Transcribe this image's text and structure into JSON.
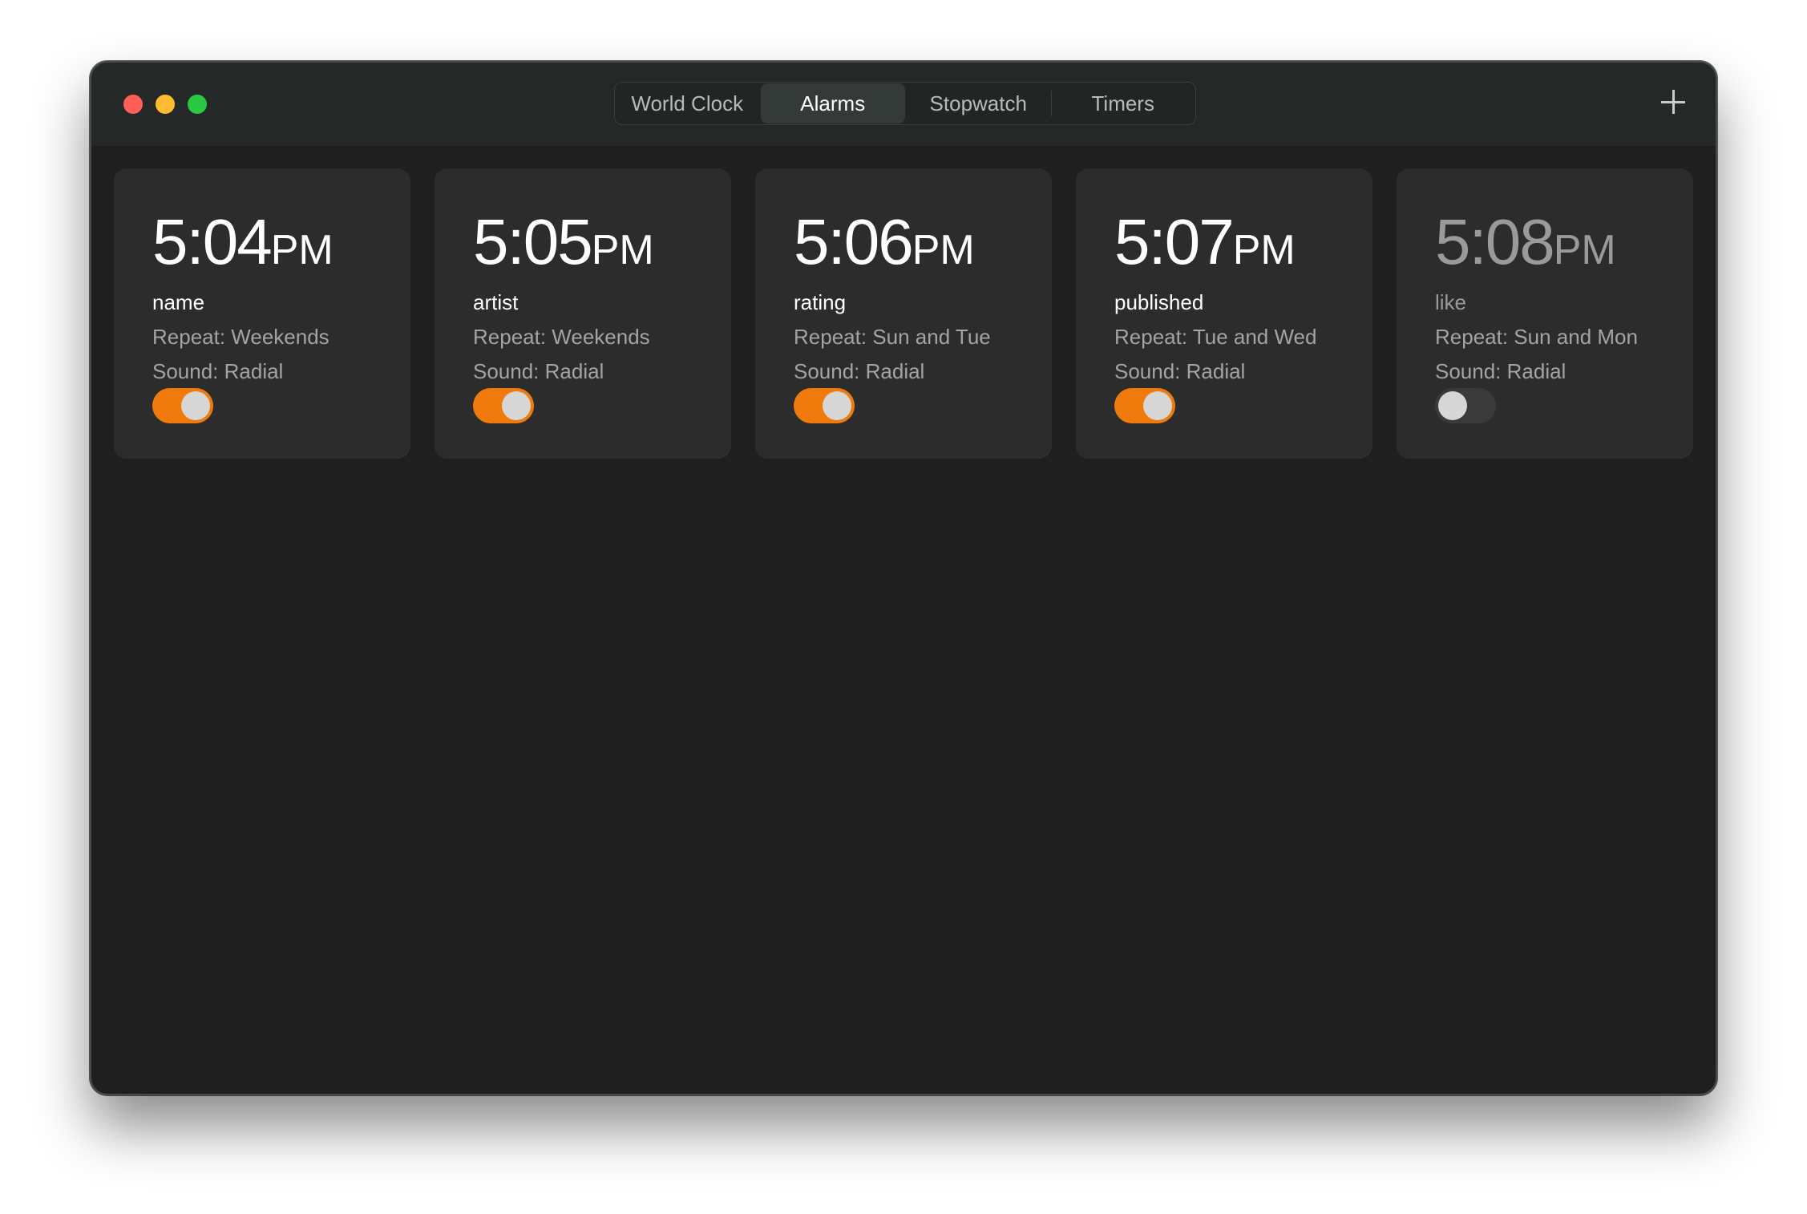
{
  "tabs": [
    {
      "label": "World Clock",
      "active": false
    },
    {
      "label": "Alarms",
      "active": true
    },
    {
      "label": "Stopwatch",
      "active": false
    },
    {
      "label": "Timers",
      "active": false
    }
  ],
  "add_icon": "plus-icon",
  "colors": {
    "accent": "#f07a0c",
    "window_bg": "#1f1f1f",
    "card_bg": "#2c2c2c"
  },
  "alarms": [
    {
      "time": "5:04",
      "ampm": "PM",
      "label": "name",
      "repeat": "Repeat: Weekends",
      "sound": "Sound: Radial",
      "enabled": true
    },
    {
      "time": "5:05",
      "ampm": "PM",
      "label": "artist",
      "repeat": "Repeat: Weekends",
      "sound": "Sound: Radial",
      "enabled": true
    },
    {
      "time": "5:06",
      "ampm": "PM",
      "label": "rating",
      "repeat": "Repeat: Sun and Tue",
      "sound": "Sound: Radial",
      "enabled": true
    },
    {
      "time": "5:07",
      "ampm": "PM",
      "label": "published",
      "repeat": "Repeat: Tue and Wed",
      "sound": "Sound: Radial",
      "enabled": true
    },
    {
      "time": "5:08",
      "ampm": "PM",
      "label": "like",
      "repeat": "Repeat: Sun and Mon",
      "sound": "Sound: Radial",
      "enabled": false
    }
  ]
}
